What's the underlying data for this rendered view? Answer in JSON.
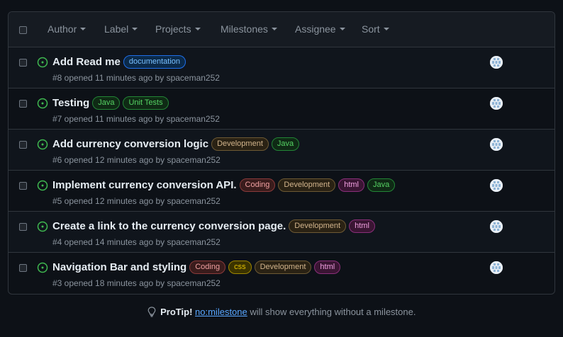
{
  "toolbar": {
    "filters": [
      "Author",
      "Label",
      "Projects",
      "Milestones",
      "Assignee",
      "Sort"
    ]
  },
  "colors": {
    "open_icon": "#3fb950",
    "link": "#58a6ff"
  },
  "issues": [
    {
      "title": "Add Read me",
      "meta": "#8 opened 11 minutes ago by spaceman252",
      "labels": [
        {
          "name": "documentation",
          "fg": "#79c0ff",
          "bg": "#0b2a4a",
          "border": "#1f6feb"
        }
      ]
    },
    {
      "title": "Testing",
      "meta": "#7 opened 11 minutes ago by spaceman252",
      "labels": [
        {
          "name": "Java",
          "fg": "#56d364",
          "bg": "#0f2a15",
          "border": "#238636"
        },
        {
          "name": "Unit Tests",
          "fg": "#56d364",
          "bg": "#0f2a15",
          "border": "#238636"
        }
      ]
    },
    {
      "title": "Add currency conversion logic",
      "meta": "#6 opened 12 minutes ago by spaceman252",
      "labels": [
        {
          "name": "Development",
          "fg": "#d2b48c",
          "bg": "#2a2214",
          "border": "#6e5a34"
        },
        {
          "name": "Java",
          "fg": "#56d364",
          "bg": "#0f2a15",
          "border": "#238636"
        }
      ]
    },
    {
      "title": "Implement currency conversion API.",
      "meta": "#5 opened 12 minutes ago by spaceman252",
      "labels": [
        {
          "name": "Coding",
          "fg": "#f0a0a0",
          "bg": "#3a1c1c",
          "border": "#8b3a3a"
        },
        {
          "name": "Development",
          "fg": "#d2b48c",
          "bg": "#2a2214",
          "border": "#6e5a34"
        },
        {
          "name": "html",
          "fg": "#f0a0e0",
          "bg": "#3a1533",
          "border": "#8b2f7a"
        },
        {
          "name": "Java",
          "fg": "#56d364",
          "bg": "#0f2a15",
          "border": "#238636"
        }
      ]
    },
    {
      "title": "Create a link to the currency conversion page.",
      "meta": "#4 opened 14 minutes ago by spaceman252",
      "labels": [
        {
          "name": "Development",
          "fg": "#d2b48c",
          "bg": "#2a2214",
          "border": "#6e5a34"
        },
        {
          "name": "html",
          "fg": "#f0a0e0",
          "bg": "#3a1533",
          "border": "#8b2f7a"
        }
      ]
    },
    {
      "title": "Navigation Bar and styling",
      "meta": "#3 opened 18 minutes ago by spaceman252",
      "labels": [
        {
          "name": "Coding",
          "fg": "#f0a0a0",
          "bg": "#3a1c1c",
          "border": "#8b3a3a"
        },
        {
          "name": "css",
          "fg": "#e3c000",
          "bg": "#3b3300",
          "border": "#9e8600"
        },
        {
          "name": "Development",
          "fg": "#d2b48c",
          "bg": "#2a2214",
          "border": "#6e5a34"
        },
        {
          "name": "html",
          "fg": "#f0a0e0",
          "bg": "#3a1533",
          "border": "#8b2f7a"
        }
      ]
    }
  ],
  "protip": {
    "lead": "ProTip!",
    "link": "no:milestone",
    "rest": " will show everything without a milestone."
  }
}
